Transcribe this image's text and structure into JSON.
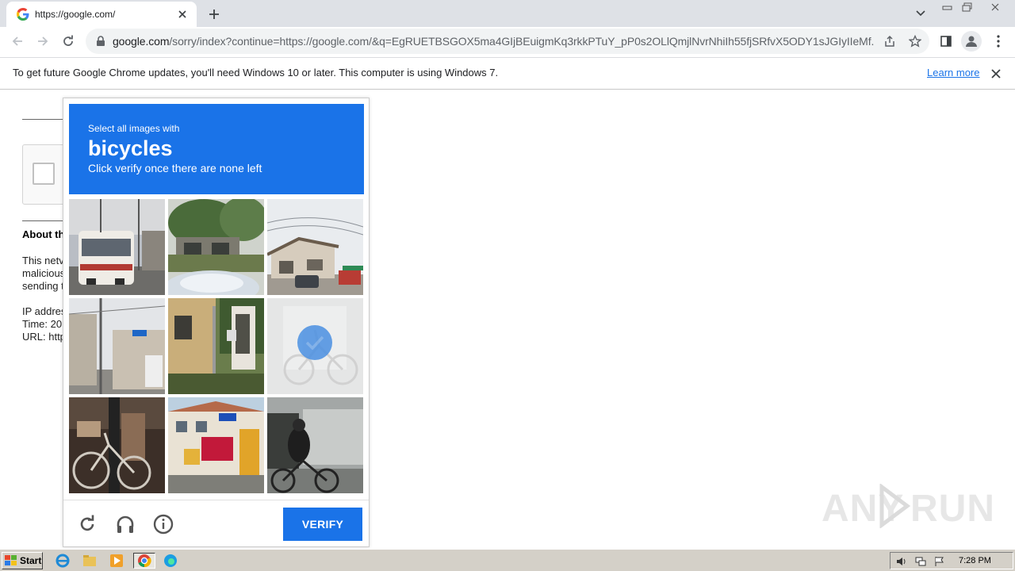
{
  "browser": {
    "tab_title": "https://google.com/",
    "url_host": "google.com",
    "url_path": "/sorry/index?continue=https://google.com/&q=EgRUETBSGOX5ma4GIjBEuigmKq3rkkPTuY_pP0s2OLlQmjlNvrNhiIh55fjSRfvX5ODY1sJGIyIIeMf..."
  },
  "infobar": {
    "message": "To get future Google Chrome updates, you'll need Windows 10 or later. This computer is using Windows 7.",
    "link": "Learn more"
  },
  "page": {
    "about_heading": "About th",
    "lines": [
      "This netv",
      "malicious",
      "sending t",
      "IP addres",
      "Time: 20",
      "URL: http"
    ]
  },
  "captcha": {
    "instruction": "Select all images with",
    "target": "bicycles",
    "subtitle": "Click verify once there are none left",
    "verify_label": "VERIFY",
    "selected_tile": 6,
    "accent": "#1a73e8"
  },
  "watermark": {
    "left": "ANY",
    "right": "RUN"
  },
  "taskbar": {
    "start_label": "Start",
    "clock": "7:28 PM"
  }
}
